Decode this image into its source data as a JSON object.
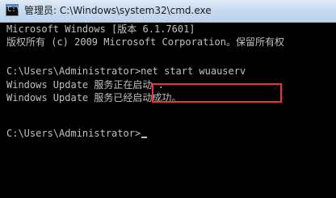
{
  "window": {
    "title": "管理员: C:\\Windows\\system32\\cmd.exe",
    "icon": "cmd-icon",
    "icon_glyph": "C:\\"
  },
  "console": {
    "lines": [
      "Microsoft Windows [版本 6.1.7601]",
      "版权所有 (c) 2009 Microsoft Corporation。保留所有权",
      "C:\\Users\\Administrator>net start wuauserv",
      "Windows Update 服务正在启动 .",
      "Windows Update 服务已经启动成功。",
      "C:\\Users\\Administrator>"
    ]
  },
  "annotation": {
    "highlight_color": "#e8333a",
    "highlighted_text": "net start wuauserv"
  }
}
